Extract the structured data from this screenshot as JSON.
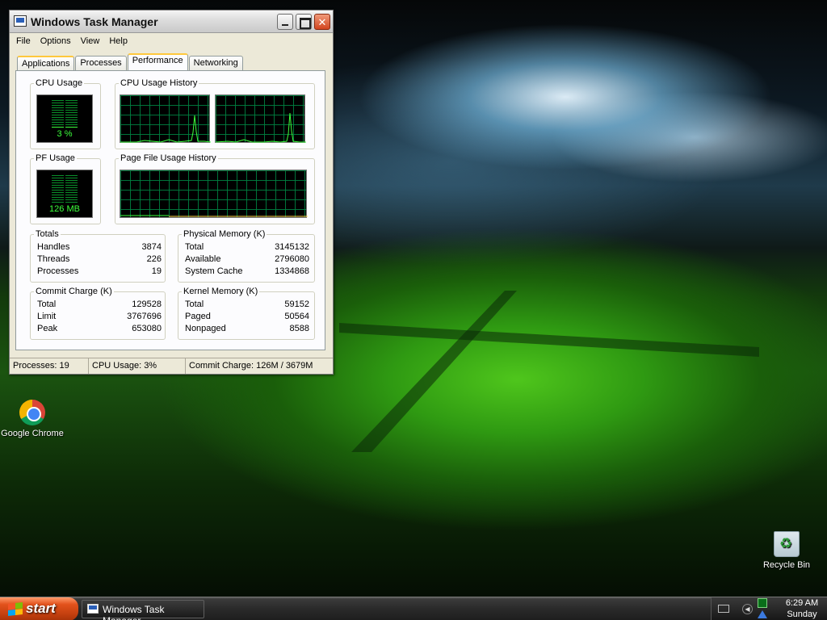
{
  "desktop": {
    "icons": [
      {
        "label": "Google Chrome"
      },
      {
        "label": "Recycle Bin"
      }
    ]
  },
  "window": {
    "title": "Windows Task Manager",
    "menu": [
      "File",
      "Options",
      "View",
      "Help"
    ],
    "tabs": [
      {
        "label": "Applications",
        "state": "hover"
      },
      {
        "label": "Processes",
        "state": "normal"
      },
      {
        "label": "Performance",
        "state": "active"
      },
      {
        "label": "Networking",
        "state": "normal"
      }
    ],
    "performance": {
      "cpu_usage": {
        "label": "CPU Usage",
        "value": "3 %",
        "fraction": 0.03
      },
      "cpu_history": {
        "label": "CPU Usage History"
      },
      "pf_usage": {
        "label": "PF Usage",
        "value": "126 MB"
      },
      "pf_history": {
        "label": "Page File Usage History"
      },
      "totals": {
        "label": "Totals",
        "rows": [
          {
            "name": "Handles",
            "value": "3874"
          },
          {
            "name": "Threads",
            "value": "226"
          },
          {
            "name": "Processes",
            "value": "19"
          }
        ]
      },
      "physical_memory": {
        "label": "Physical Memory (K)",
        "rows": [
          {
            "name": "Total",
            "value": "3145132"
          },
          {
            "name": "Available",
            "value": "2796080"
          },
          {
            "name": "System Cache",
            "value": "1334868"
          }
        ]
      },
      "commit_charge": {
        "label": "Commit Charge (K)",
        "rows": [
          {
            "name": "Total",
            "value": "129528"
          },
          {
            "name": "Limit",
            "value": "3767696"
          },
          {
            "name": "Peak",
            "value": "653080"
          }
        ]
      },
      "kernel_memory": {
        "label": "Kernel Memory (K)",
        "rows": [
          {
            "name": "Total",
            "value": "59152"
          },
          {
            "name": "Paged",
            "value": "50564"
          },
          {
            "name": "Nonpaged",
            "value": "8588"
          }
        ]
      }
    },
    "status": {
      "processes": "Processes: 19",
      "cpu": "CPU Usage: 3%",
      "commit": "Commit Charge: 126M / 3679M"
    }
  },
  "taskbar": {
    "start_label": "start",
    "task_label": "Windows Task Manager",
    "clock_time": "6:29 AM",
    "clock_day": "Sunday"
  },
  "colors": {
    "graph_line": "#3cff3c",
    "pf_line": "#ffd84a",
    "grid": "#008040"
  }
}
